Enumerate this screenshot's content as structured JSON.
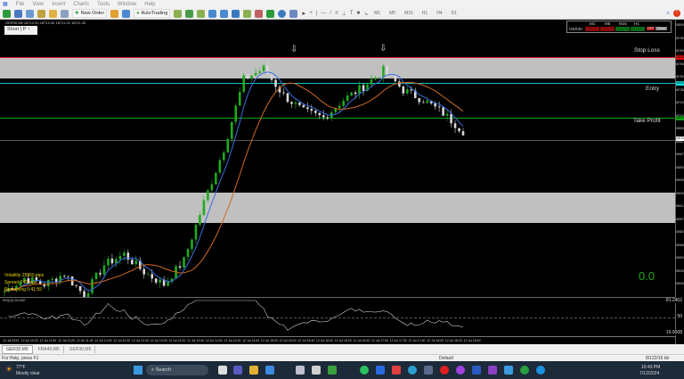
{
  "menu": [
    "File",
    "View",
    "Insert",
    "Charts",
    "Tools",
    "Window",
    "Help"
  ],
  "toolbar": {
    "new_order": "New Order",
    "autotrading": "AutoTrading",
    "timeframes": [
      "M1",
      "M5",
      "M15",
      "H1",
      "H4",
      "D1"
    ]
  },
  "chart": {
    "symbol_header": "GER30,M5  18712.00 18713.40 18711.20 18711.30",
    "strategy_tab": "Short | P",
    "close_tab": "×",
    "stop_loss_label": "Stop Loss",
    "entry_label": "Entry",
    "take_profit_label": "Take Profit",
    "stop_loss_price": "18783.00",
    "entry_price": "18762.00",
    "take_profit_price": "18737.00",
    "bid_price": "18711.30",
    "info": {
      "volatility": "Volatility  25950 pips",
      "spread": "Spread  740 pips",
      "remaining": "Remaining  0:41:55"
    },
    "result": "0.0",
    "price_ticks": [
      "18809.16",
      "18795.16",
      "18780.96",
      "18766.76",
      "18752.76",
      "18738.56",
      "18724.36",
      "18710.16",
      "18696.16",
      "18681.96",
      "18667.76",
      "18653.56",
      "18639.56",
      "18625.36",
      "18611.16",
      "18597.16",
      "18582.96",
      "18568.76",
      "18554.56",
      "18540.56",
      "18526.36"
    ],
    "time_ticks": [
      "12 Jul 2024",
      "12 Jul 10:20",
      "12 Jul 11:00",
      "12 Jul 11:20",
      "12 Jul 11:40",
      "12 Jul 12:00",
      "12 Jul 12:20",
      "12 Jul 12:40",
      "12 Jul 13:00",
      "12 Jul 13:20",
      "12 Jul 13:40",
      "12 Jul 14:00",
      "12 Jul 14:20",
      "12 Jul 14:40",
      "12 Jul 15:00",
      "12 Jul 15:20",
      "12 Jul 15:40",
      "12 Jul 16:00",
      "12 Jul 16:20",
      "12 Jul 16:40",
      "12 Jul 17:00",
      "12 Jul 17:20",
      "12 Jul 17:40",
      "12 Jul 18:00",
      "12 Jul 18:20",
      "12 Jul 18:40"
    ],
    "price_keypoints": [
      18540,
      18555,
      18548,
      18560,
      18536,
      18570,
      18582,
      18562,
      18548,
      18575,
      18640,
      18700,
      18778,
      18790,
      18760,
      18742,
      18735,
      18755,
      18770,
      18788,
      18766,
      18755,
      18740,
      18720
    ],
    "colors": {
      "up": "#1faa1f",
      "down": "#d8d8d8",
      "ma_fast": "#3a6fe0",
      "ma_slow": "#d06a20",
      "stop": "#e01010",
      "entry": "#10e0e0",
      "tp": "#10a010"
    }
  },
  "panel": {
    "symbol": "GER30",
    "tfs": [
      "M1",
      "M5",
      "M15",
      "H1"
    ],
    "off": "OFF",
    "close": "Close"
  },
  "indicator": {
    "label": "RSI(14) 26.0387",
    "levels": [
      "81.2402",
      "50",
      "16.9008"
    ]
  },
  "tabs": [
    "GER30,M5",
    "FRA40,M5",
    "GER30,M5"
  ],
  "status": {
    "help": "For Help, press F1",
    "profile": "Default",
    "traffic": "8/122/16 kb"
  },
  "taskbar": {
    "weather_temp": "77°F",
    "weather_desc": "Mostly clear",
    "search": "Search",
    "time": "10:43 PM",
    "date": "7/12/2024"
  }
}
